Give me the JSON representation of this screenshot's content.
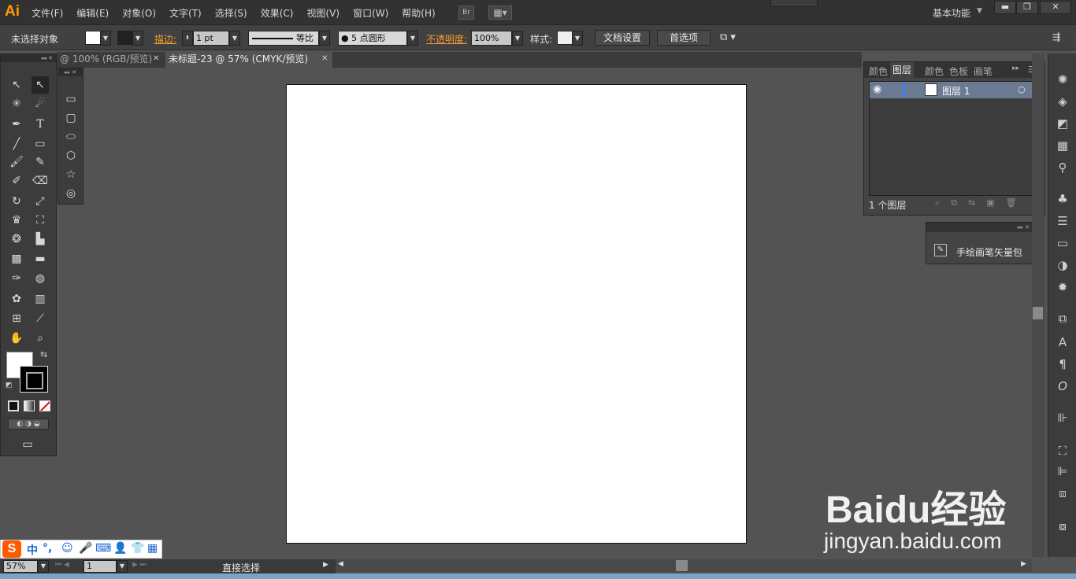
{
  "app": {
    "logo": "Ai"
  },
  "menu": [
    "文件(F)",
    "编辑(E)",
    "对象(O)",
    "文字(T)",
    "选择(S)",
    "效果(C)",
    "视图(V)",
    "窗口(W)",
    "帮助(H)"
  ],
  "menubar": {
    "bridge_label": "Br",
    "workspace": "基本功能"
  },
  "controlbar": {
    "selection_label": "未选择对象",
    "stroke_label": "描边:",
    "stroke_weight": "1 pt",
    "stroke_profile": "等比",
    "brush": "5 点圆形",
    "opacity_label": "不透明度:",
    "opacity_value": "100%",
    "style_label": "样式:",
    "doc_setup_button": "文档设置",
    "preferences_button": "首选项"
  },
  "tabs": [
    {
      "label": "@ 100% (RGB/预览)",
      "active": false
    },
    {
      "label": "未标题-23 @ 57% (CMYK/预览)",
      "active": true
    }
  ],
  "layers_panel": {
    "tabs": [
      "颜色",
      "图层",
      "颜色",
      "色板",
      "画笔"
    ],
    "active_tab": "图层",
    "layer_name": "图层 1",
    "layer_count": "1 个图层"
  },
  "brush_panel": {
    "item_label": "手绘画笔矢量包"
  },
  "statusbar": {
    "zoom": "57%",
    "artboard_number": "1",
    "status_text": "直接选择"
  },
  "ime": {
    "mode": "中"
  },
  "watermark": {
    "logo": "Baidu经验",
    "url": "jingyan.baidu.com"
  },
  "colors": {
    "accent_orange": "#ff9a00",
    "panel_bg": "#3c3c3c",
    "canvas_bg": "#535353",
    "artboard": "#ffffff",
    "layer_highlight": "#6a7a93"
  }
}
